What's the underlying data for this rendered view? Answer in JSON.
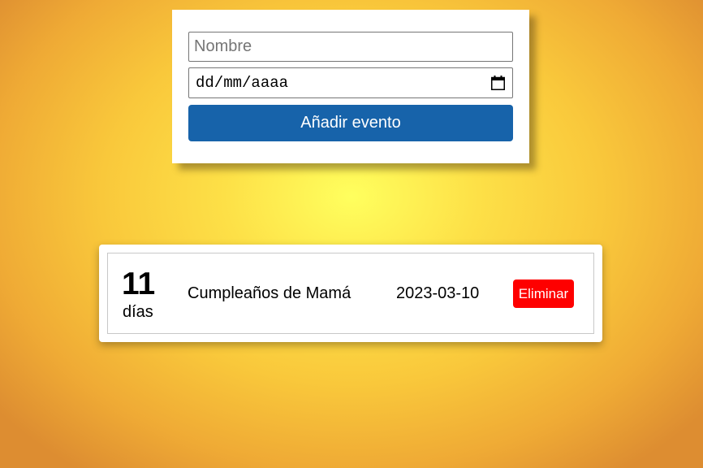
{
  "form": {
    "name_placeholder": "Nombre",
    "name_value": "",
    "date_placeholder": "dd/mm/aaaa",
    "date_icon": "calendar-icon",
    "add_label": "Añadir evento"
  },
  "events": [
    {
      "days": "11",
      "days_label": "días",
      "name": "Cumpleaños de Mamá",
      "date": "2023-03-10",
      "delete_label": "Eliminar"
    }
  ],
  "colors": {
    "add_button": "#1763aa",
    "delete_button": "#fe0000",
    "background_center": "#ffff5e",
    "background_edge": "#dd8d31"
  }
}
